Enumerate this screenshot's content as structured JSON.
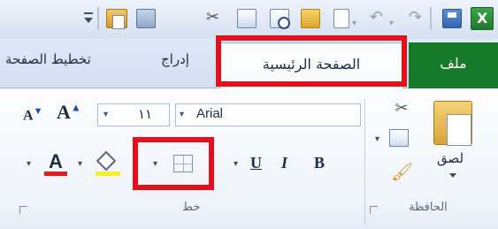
{
  "quick_access": {
    "icons": [
      "excel-icon",
      "save-icon",
      "redo-icon",
      "undo-icon",
      "new-document-icon",
      "open-folder-icon",
      "print-preview-icon",
      "copy-icon",
      "cut-icon",
      "paint-bucket-icon",
      "paste-icon",
      "customize-toolbar-icon"
    ],
    "undo_glyph": "↶",
    "redo_glyph": "↷",
    "cut_glyph": "✂"
  },
  "tabs": {
    "file": "ملف",
    "home": "الصفحة الرئيسية",
    "insert": "إدراج",
    "page_layout": "تخطيط الصفحة"
  },
  "clipboard": {
    "paste_label": "لصق",
    "cut_glyph": "✂",
    "brush_glyph": "🖌",
    "caption": "الحافظة"
  },
  "font": {
    "name": "Arial",
    "size": "١١",
    "grow_label": "A",
    "grow_sup": "▲",
    "shrink_label": "A",
    "shrink_sup": "▼",
    "bold": "B",
    "italic": "I",
    "underline": "U",
    "font_color_letter": "A",
    "caption": "خط",
    "dropdown_glyph": "▾",
    "font_color_bar": "#e31b23",
    "fill_color_bar": "#f5ef2a"
  },
  "colors": {
    "file_tab": "#177a2a",
    "highlight": "#e3111d"
  }
}
